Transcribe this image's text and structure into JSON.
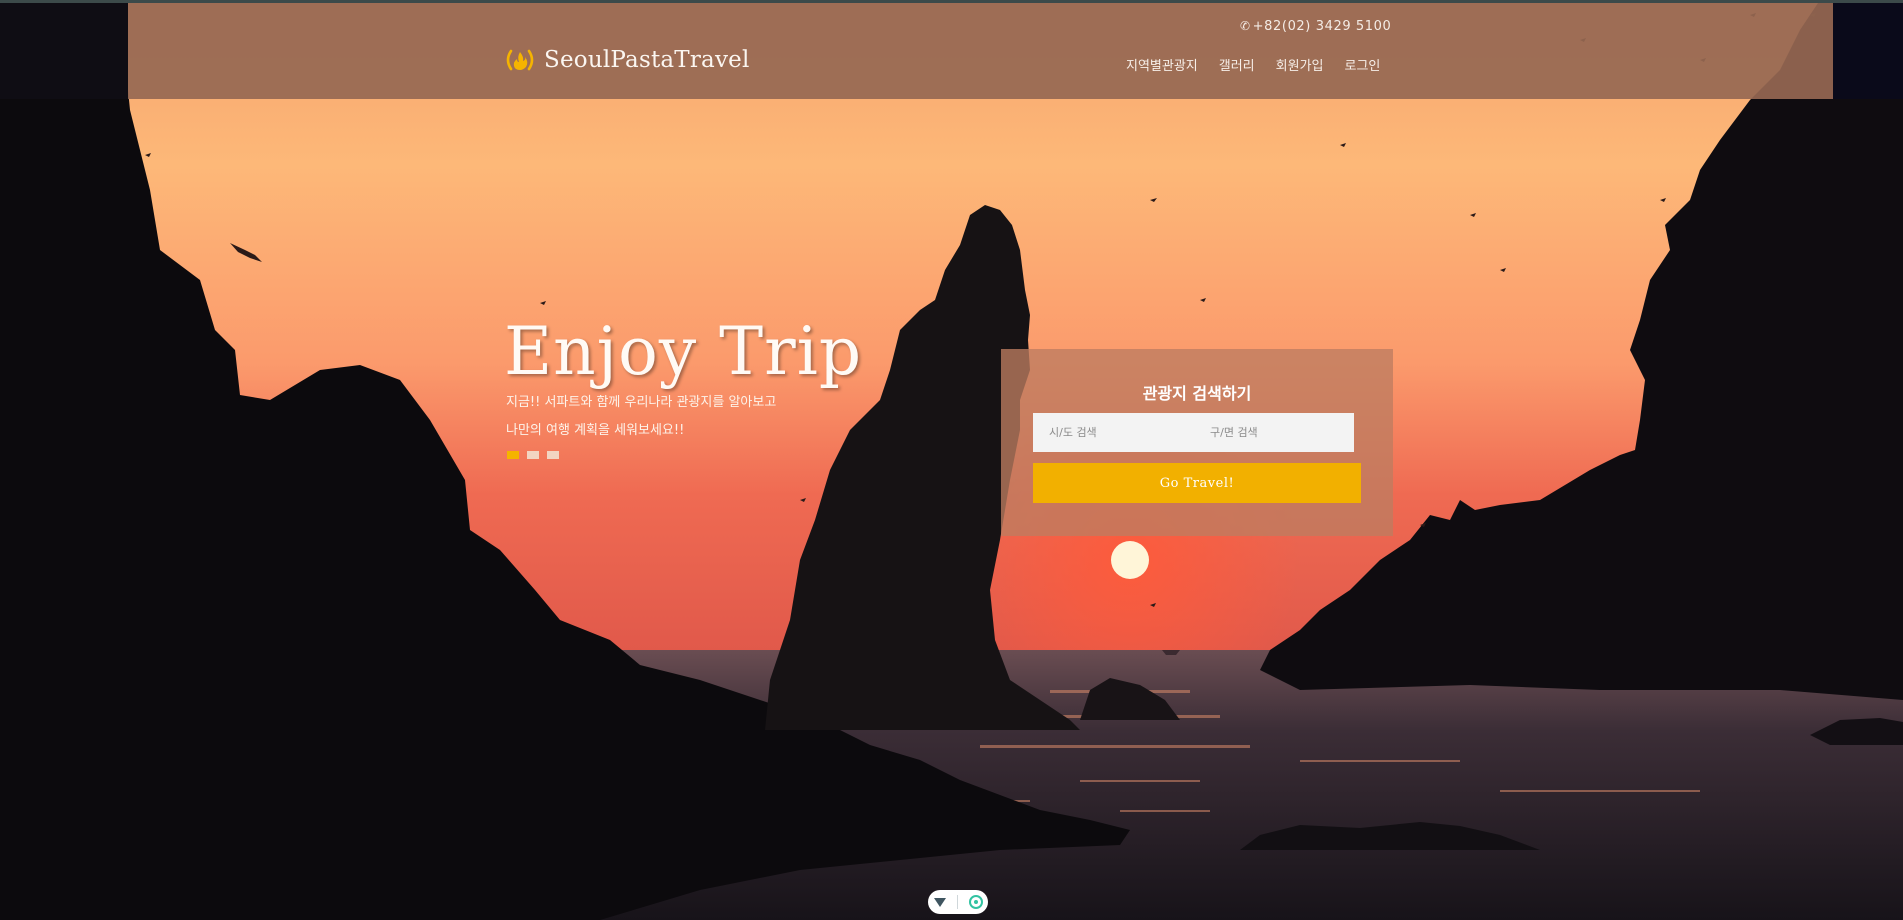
{
  "header": {
    "phone": "+82(02) 3429 5100",
    "phone_icon": "phone-icon",
    "brand": "SeoulPastaTravel",
    "brand_icon": "flame-logo-icon",
    "nav": [
      "지역별관광지",
      "갤러리",
      "회원가입",
      "로그인"
    ]
  },
  "hero": {
    "title": "Enjoy Trip",
    "subtitle_line1": "지금!! 서파트와 함께 우리나라 관광지를 알아보고",
    "subtitle_line2": "나만의 여행 계획을 세워보세요!!",
    "slides": 3,
    "active_slide": 1
  },
  "search": {
    "title": "관광지 검색하기",
    "city_placeholder": "시/도 검색",
    "district_placeholder": "구/면 검색",
    "button_label": "Go Travel!"
  },
  "colors": {
    "accent": "#f2b000",
    "header_bg": "#966852",
    "panel_bg": "#be7c60"
  },
  "bottom_widget": {
    "icons": [
      "down-arrow-icon",
      "target-icon"
    ]
  }
}
